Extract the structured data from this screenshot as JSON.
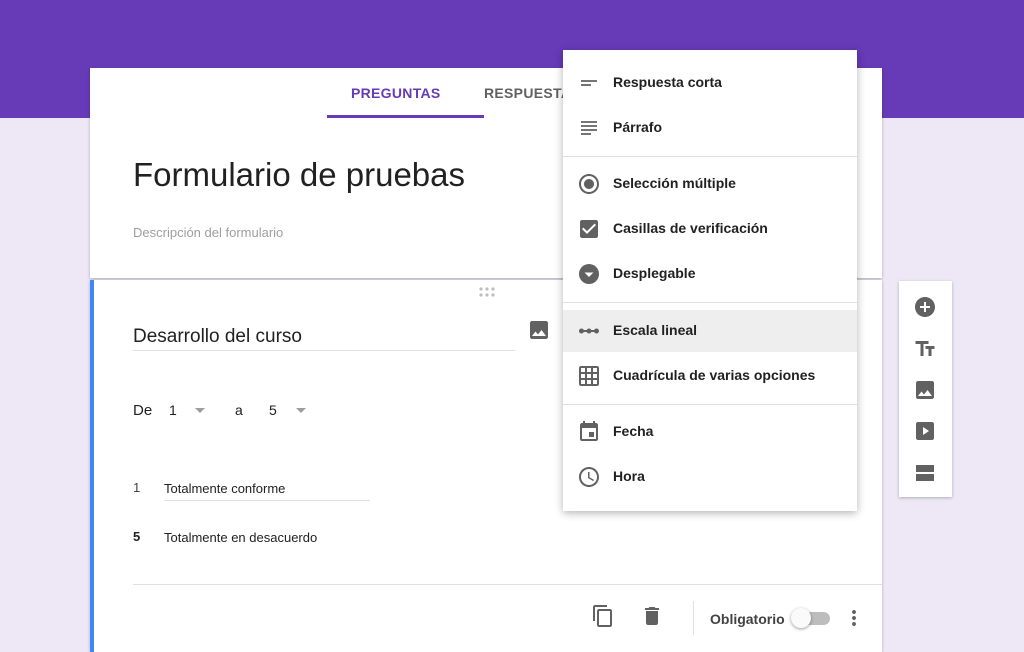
{
  "colors": {
    "brand": "#673ab7",
    "background": "#ede7f6",
    "question_accent": "#4285f4",
    "icon_gray": "#616161"
  },
  "tabs": [
    {
      "label": "PREGUNTAS",
      "active": true
    },
    {
      "label": "RESPUESTA",
      "active": false
    }
  ],
  "form": {
    "title": "Formulario de pruebas",
    "description": "Descripción del formulario"
  },
  "question": {
    "title": "Desarrollo del curso",
    "range_from_label": "De",
    "range_from_value": "1",
    "range_to_label": "a",
    "range_to_value": "5",
    "min_label_num": "1",
    "min_label_text": "Totalmente conforme",
    "max_label_num": "5",
    "max_label_text": "Totalmente en desacuerdo",
    "required_label": "Obligatorio",
    "required_on": false,
    "icons": {
      "drag": "drag-handle-icon",
      "image": "image-icon",
      "copy": "copy-icon",
      "delete": "trash-icon",
      "more": "more-vert-icon"
    }
  },
  "menu": {
    "items": [
      {
        "label": "Respuesta corta",
        "icon": "short-answer-icon"
      },
      {
        "label": "Párrafo",
        "icon": "paragraph-icon"
      },
      {
        "label": "Selección múltiple",
        "icon": "radio-button-icon"
      },
      {
        "label": "Casillas de verificación",
        "icon": "checkbox-icon"
      },
      {
        "label": "Desplegable",
        "icon": "dropdown-icon"
      },
      {
        "label": "Escala lineal",
        "icon": "linear-scale-icon",
        "highlighted": true
      },
      {
        "label": "Cuadrícula de varias opciones",
        "icon": "grid-icon"
      },
      {
        "label": "Fecha",
        "icon": "calendar-icon"
      },
      {
        "label": "Hora",
        "icon": "clock-icon"
      }
    ]
  },
  "toolbar": {
    "icons": [
      "add-question-icon",
      "title-text-icon",
      "add-image-icon",
      "add-video-icon",
      "add-section-icon"
    ]
  }
}
